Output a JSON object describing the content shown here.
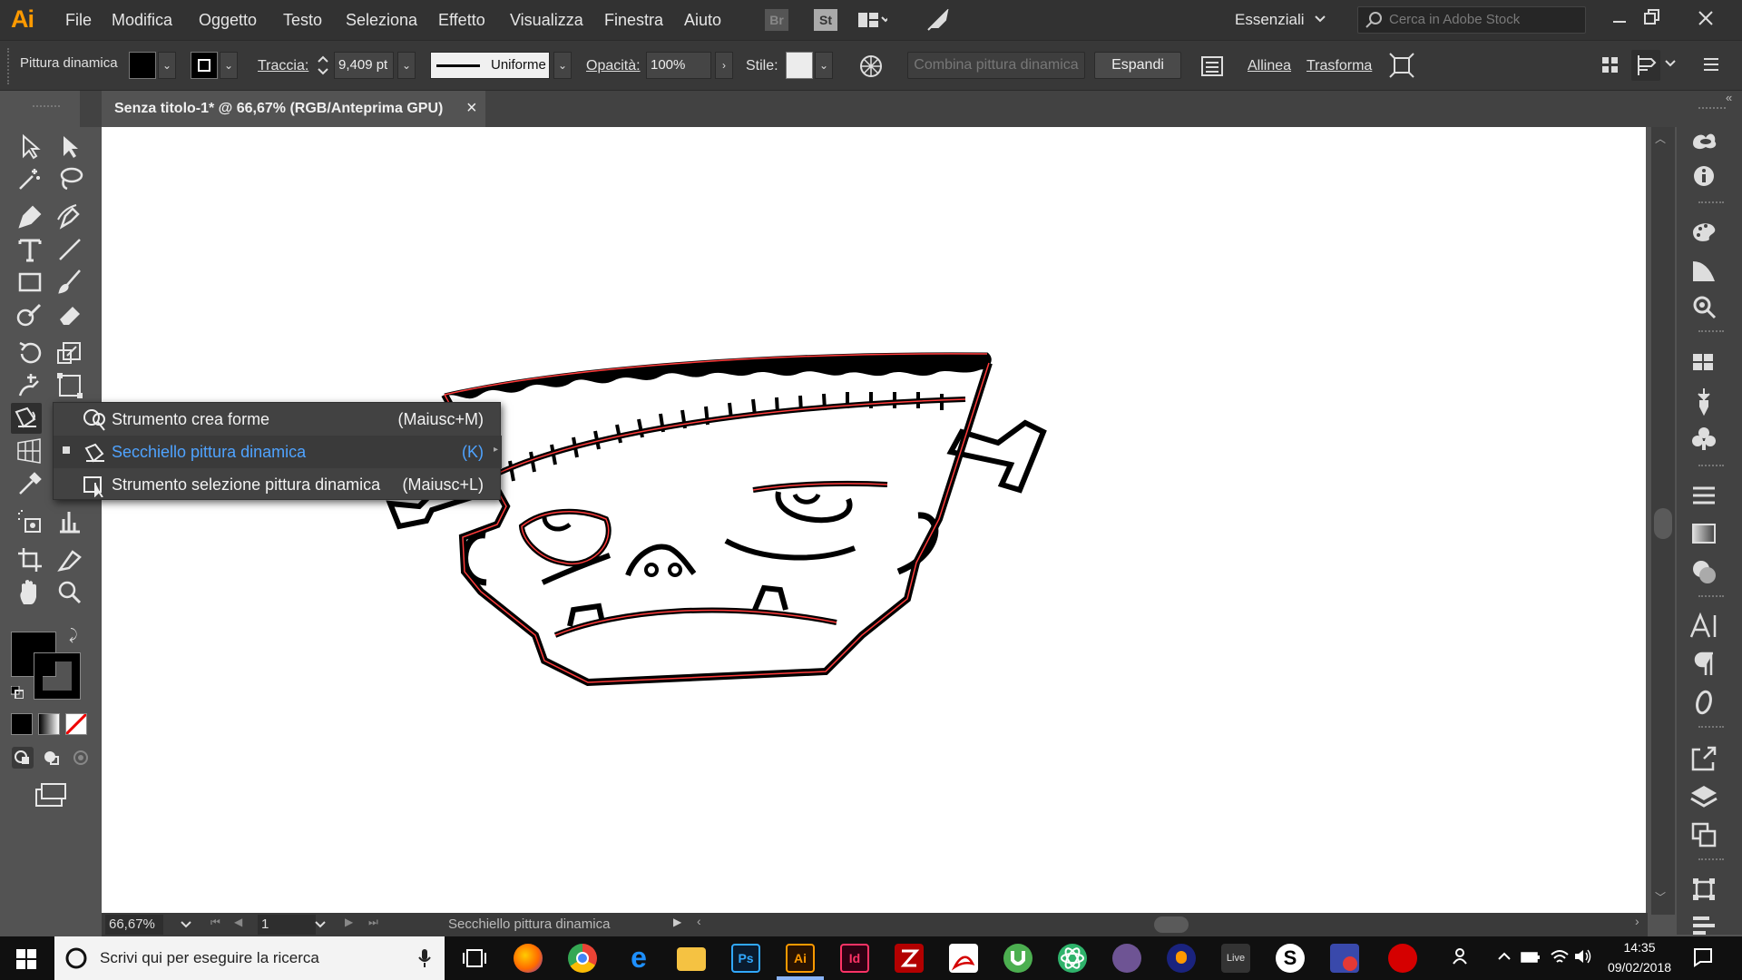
{
  "menubar": {
    "logo": "Ai",
    "items": [
      "File",
      "Modifica",
      "Oggetto",
      "Testo",
      "Seleziona",
      "Effetto",
      "Visualizza",
      "Finestra",
      "Aiuto"
    ],
    "bridge_label": "Br",
    "stock_label": "St",
    "workspace": "Essenziali",
    "search_placeholder": "Cerca in Adobe Stock"
  },
  "controlbar": {
    "tool_name": "Pittura dinamica",
    "stroke_label": "Traccia:",
    "stroke_value": "9,409 pt",
    "profile": "Uniforme",
    "opacity_label": "Opacità:",
    "opacity_value": "100%",
    "style_label": "Stile:",
    "merge_label": "Combina pittura dinamica",
    "expand_label": "Espandi",
    "align_label": "Allinea",
    "transform_label": "Trasforma"
  },
  "document": {
    "tab_title": "Senza titolo-1* @ 66,67% (RGB/Anteprima GPU)",
    "close_symbol": "×"
  },
  "flyout": {
    "items": [
      {
        "label": "Strumento crea forme",
        "shortcut": "(Maiusc+M)",
        "selected": false
      },
      {
        "label": "Secchiello pittura dinamica",
        "shortcut": "(K)",
        "selected": true
      },
      {
        "label": "Strumento selezione pittura dinamica",
        "shortcut": "(Maiusc+L)",
        "selected": false
      }
    ]
  },
  "statusbar": {
    "zoom": "66,67%",
    "artboard_number": "1",
    "current_tool": "Secchiello pittura dinamica"
  },
  "taskbar": {
    "search_placeholder": "Scrivi qui per eseguire la ricerca",
    "time": "14:35",
    "date": "09/02/2018",
    "live_label": "Live",
    "app_labels": {
      "photoshop": "Ps",
      "illustrator": "Ai",
      "indesign": "Id"
    }
  },
  "colors": {
    "accent": "#4fa3ff",
    "illustrator_orange": "#ff9a00",
    "path_highlight": "#ff3b3b",
    "fill": "#000000"
  }
}
